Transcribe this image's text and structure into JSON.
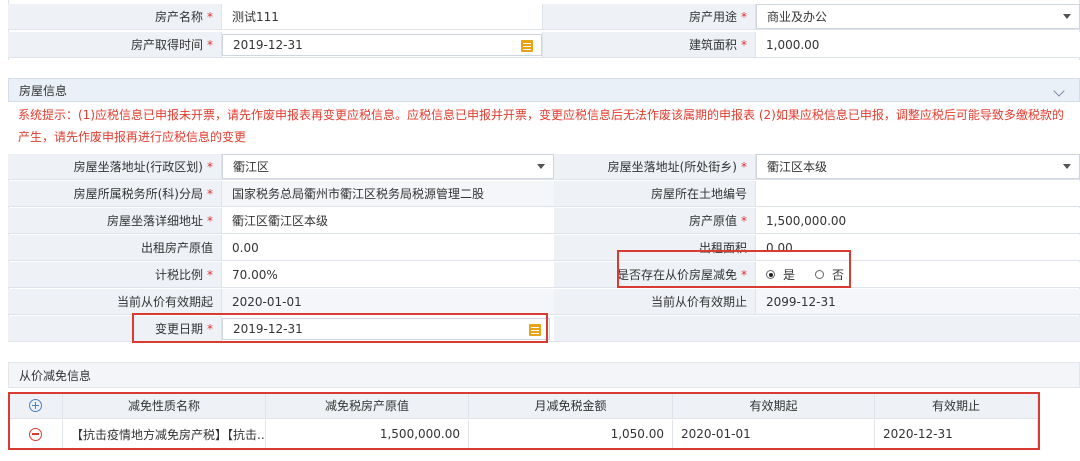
{
  "top": {
    "property_name_label": "房产名称",
    "property_name_value": "测试111",
    "property_use_label": "房产用途",
    "property_use_value": "商业及办公",
    "acquire_date_label": "房产取得时间",
    "acquire_date_value": "2019-12-31",
    "building_area_label": "建筑面积",
    "building_area_value": "1,000.00"
  },
  "house": {
    "section_title": "房屋信息",
    "notice": "系统提示：(1)应税信息已申报未开票，请先作废申报表再变更应税信息。应税信息已申报并开票，变更应税信息后无法作废该属期的申报表 (2)如果应税信息已申报，调整应税后可能导致多缴税款的产生，请先作废申报再进行应税信息的变更",
    "district_label": "房屋坐落地址(行政区划)",
    "district_value": "衢江区",
    "street_label": "房屋坐落地址(所处街乡)",
    "street_value": "衢江区本级",
    "tax_office_label": "房屋所属税务所(科)分局",
    "tax_office_value": "国家税务总局衢州市衢江区税务局税源管理二股",
    "land_no_label": "房屋所在土地编号",
    "land_no_value": "",
    "address_label": "房屋坐落详细地址",
    "address_value": "衢江区衢江区本级",
    "original_value_label": "房产原值",
    "original_value_value": "1,500,000.00",
    "rent_original_label": "出租房产原值",
    "rent_original_value": "0.00",
    "rent_area_label": "出租面积",
    "rent_area_value": "0.00",
    "tax_ratio_label": "计税比例",
    "tax_ratio_value": "70.00%",
    "reduction_label": "是否存在从价房屋减免",
    "reduction_yes": "是",
    "reduction_no": "否",
    "reduction_selected": "yes",
    "valid_from_label": "当前从价有效期起",
    "valid_from_value": "2020-01-01",
    "valid_to_label": "当前从价有效期止",
    "valid_to_value": "2099-12-31",
    "change_date_label": "变更日期",
    "change_date_value": "2019-12-31"
  },
  "relief": {
    "section_title": "从价减免信息",
    "columns": [
      "减免性质名称",
      "减免税房产原值",
      "月减免税金额",
      "有效期起",
      "有效期止"
    ],
    "rows": [
      {
        "name": "【抗击疫情地方减免房产税】【抗击...",
        "original_value": "1,500,000.00",
        "monthly_amount": "1,050.00",
        "valid_from": "2020-01-01",
        "valid_to": "2020-12-31"
      }
    ]
  },
  "icons": {
    "add": "plus-circle-icon",
    "remove": "minus-circle-icon",
    "calendar": "calendar-icon",
    "dropdown": "chevron-down-icon",
    "collapse": "chevron-down-icon"
  },
  "colors": {
    "required": "#e03030",
    "notice": "#e23c2f",
    "highlight_box": "#d83b32",
    "label_bg": "#eef2f7",
    "section_bg": "#eaf0f7"
  }
}
